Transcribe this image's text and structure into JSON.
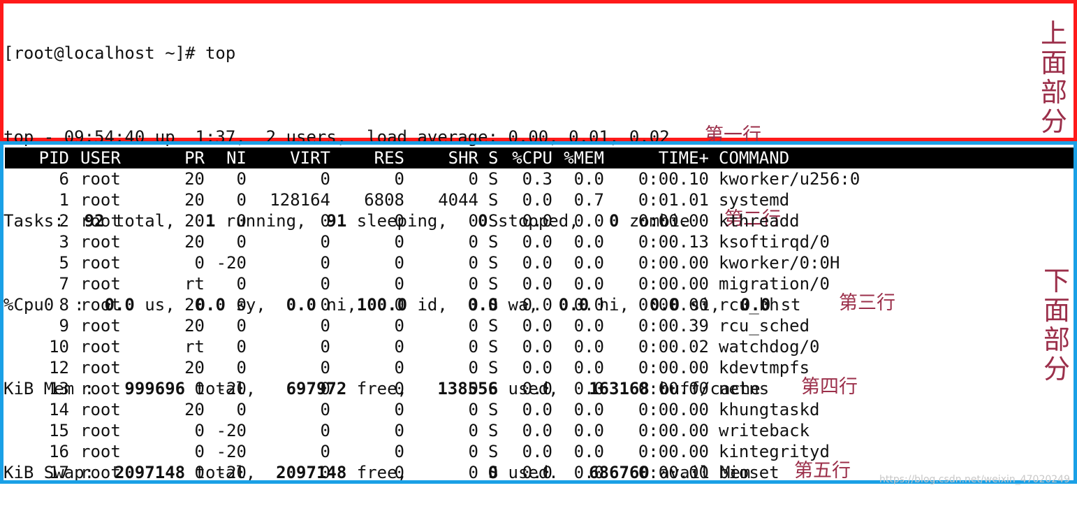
{
  "summary": {
    "prompt": "[root@localhost ~]# top",
    "line1": {
      "text": "top - 09:54:40 up  1:37,  2 users,  load average: 0.00, 0.01, 0.02",
      "annotation": "第一行"
    },
    "line2": {
      "pre": "Tasks:  ",
      "total": "92",
      "total_label": " total,   ",
      "running": "1",
      "running_label": " running,  ",
      "sleeping": "91",
      "sleeping_label": " sleeping,   ",
      "stopped": "0",
      "stopped_label": " stopped,   ",
      "zombie": "0",
      "zombie_label": " zombie",
      "annotation": "第二行"
    },
    "line3": {
      "pre": "%Cpu0  :  ",
      "us": "0.0",
      "us_label": " us,  ",
      "sy": "0.0",
      "sy_label": " sy,  ",
      "ni": "0.0",
      "ni_label": " ni,",
      "id": "100.0",
      "id_label": " id,  ",
      "wa": "0.0",
      "wa_label": " wa,  ",
      "hi": "0.0",
      "hi_label": " hi,  ",
      "si": "0.0",
      "si_label": " si,  ",
      "st": "0.0",
      "st_label": " st",
      "annotation": "第三行"
    },
    "line4": {
      "pre": "KiB Mem :   ",
      "total": "999696",
      "total_label": " total,   ",
      "free": "697972",
      "free_label": " free,   ",
      "used": "138556",
      "used_label": " used,   ",
      "buff": "163168",
      "buff_label": " buff/cache",
      "annotation": "第四行"
    },
    "line5": {
      "pre": "KiB Swap:  ",
      "total": "2097148",
      "total_label": " total,  ",
      "free": "2097148",
      "free_label": " free,        ",
      "used": "0",
      "used_label": " used.   ",
      "avail": "686760",
      "avail_label": " avail Mem",
      "annotation": "第五行"
    },
    "section_label": [
      "上",
      "面",
      "部",
      "分"
    ]
  },
  "process_table": {
    "headers": {
      "pid": "PID",
      "user": "USER",
      "pr": "PR",
      "ni": "NI",
      "virt": "VIRT",
      "res": "RES",
      "shr": "SHR",
      "s": "S",
      "cpu": "%CPU",
      "mem": "%MEM",
      "time": "TIME+",
      "command": "COMMAND"
    },
    "rows": [
      {
        "pid": "6",
        "user": "root",
        "pr": "20",
        "ni": "0",
        "virt": "0",
        "res": "0",
        "shr": "0",
        "s": "S",
        "cpu": "0.3",
        "mem": "0.0",
        "time": "0:00.10",
        "command": "kworker/u256:0"
      },
      {
        "pid": "1",
        "user": "root",
        "pr": "20",
        "ni": "0",
        "virt": "128164",
        "res": "6808",
        "shr": "4044",
        "s": "S",
        "cpu": "0.0",
        "mem": "0.7",
        "time": "0:01.01",
        "command": "systemd"
      },
      {
        "pid": "2",
        "user": "root",
        "pr": "20",
        "ni": "0",
        "virt": "0",
        "res": "0",
        "shr": "0",
        "s": "S",
        "cpu": "0.0",
        "mem": "0.0",
        "time": "0:00.00",
        "command": "kthreadd"
      },
      {
        "pid": "3",
        "user": "root",
        "pr": "20",
        "ni": "0",
        "virt": "0",
        "res": "0",
        "shr": "0",
        "s": "S",
        "cpu": "0.0",
        "mem": "0.0",
        "time": "0:00.13",
        "command": "ksoftirqd/0"
      },
      {
        "pid": "5",
        "user": "root",
        "pr": "0",
        "ni": "-20",
        "virt": "0",
        "res": "0",
        "shr": "0",
        "s": "S",
        "cpu": "0.0",
        "mem": "0.0",
        "time": "0:00.00",
        "command": "kworker/0:0H"
      },
      {
        "pid": "7",
        "user": "root",
        "pr": "rt",
        "ni": "0",
        "virt": "0",
        "res": "0",
        "shr": "0",
        "s": "S",
        "cpu": "0.0",
        "mem": "0.0",
        "time": "0:00.00",
        "command": "migration/0"
      },
      {
        "pid": "8",
        "user": "root",
        "pr": "20",
        "ni": "0",
        "virt": "0",
        "res": "0",
        "shr": "0",
        "s": "S",
        "cpu": "0.0",
        "mem": "0.0",
        "time": "0:00.00",
        "command": "rcu_bh"
      },
      {
        "pid": "9",
        "user": "root",
        "pr": "20",
        "ni": "0",
        "virt": "0",
        "res": "0",
        "shr": "0",
        "s": "S",
        "cpu": "0.0",
        "mem": "0.0",
        "time": "0:00.39",
        "command": "rcu_sched"
      },
      {
        "pid": "10",
        "user": "root",
        "pr": "rt",
        "ni": "0",
        "virt": "0",
        "res": "0",
        "shr": "0",
        "s": "S",
        "cpu": "0.0",
        "mem": "0.0",
        "time": "0:00.02",
        "command": "watchdog/0"
      },
      {
        "pid": "12",
        "user": "root",
        "pr": "20",
        "ni": "0",
        "virt": "0",
        "res": "0",
        "shr": "0",
        "s": "S",
        "cpu": "0.0",
        "mem": "0.0",
        "time": "0:00.00",
        "command": "kdevtmpfs"
      },
      {
        "pid": "13",
        "user": "root",
        "pr": "0",
        "ni": "-20",
        "virt": "0",
        "res": "0",
        "shr": "0",
        "s": "S",
        "cpu": "0.0",
        "mem": "0.0",
        "time": "0:00.00",
        "command": "netns"
      },
      {
        "pid": "14",
        "user": "root",
        "pr": "20",
        "ni": "0",
        "virt": "0",
        "res": "0",
        "shr": "0",
        "s": "S",
        "cpu": "0.0",
        "mem": "0.0",
        "time": "0:00.00",
        "command": "khungtaskd"
      },
      {
        "pid": "15",
        "user": "root",
        "pr": "0",
        "ni": "-20",
        "virt": "0",
        "res": "0",
        "shr": "0",
        "s": "S",
        "cpu": "0.0",
        "mem": "0.0",
        "time": "0:00.00",
        "command": "writeback"
      },
      {
        "pid": "16",
        "user": "root",
        "pr": "0",
        "ni": "-20",
        "virt": "0",
        "res": "0",
        "shr": "0",
        "s": "S",
        "cpu": "0.0",
        "mem": "0.0",
        "time": "0:00.00",
        "command": "kintegrityd"
      },
      {
        "pid": "17",
        "user": "root",
        "pr": "0",
        "ni": "-20",
        "virt": "0",
        "res": "0",
        "shr": "0",
        "s": "S",
        "cpu": "0.0",
        "mem": "0.0",
        "time": "0:00.00",
        "command": "bioset"
      }
    ],
    "section_label": [
      "下",
      "面",
      "部",
      "分"
    ]
  },
  "watermark": "https://blog.csdn.net/weixin_47020249",
  "colors": {
    "top_border": "#ff1a1a",
    "bottom_border": "#1aa0e6",
    "annotation": "#9b2f4a",
    "header_bg": "#000000"
  }
}
